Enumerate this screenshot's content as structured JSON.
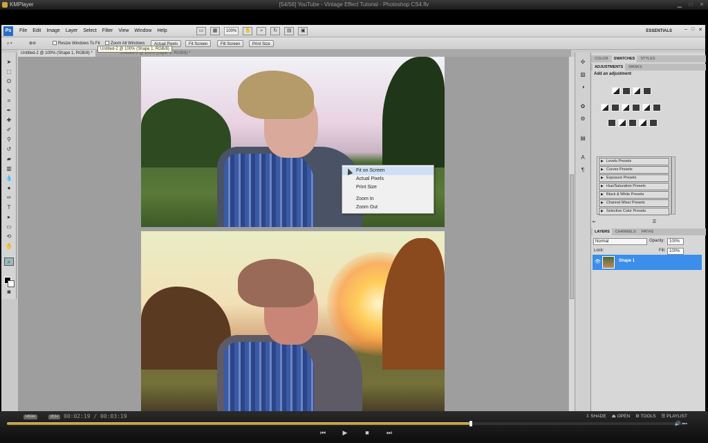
{
  "player": {
    "app_name": "KMPlayer",
    "title": "[54/56] YouTube - Vintage Effect Tutorial - Photoshop CS4.flv",
    "badge_hq": "HIGH",
    "badge_2ch": "2CH",
    "timecode": "00:02:19 / 00:03:19",
    "progress": 0.685,
    "controls": {
      "shade": "SHADE",
      "open": "OPEN",
      "tools": "TOOLS",
      "playlist": "PLAYLIST"
    }
  },
  "photoshop": {
    "logo": "Ps",
    "menus": [
      "File",
      "Edit",
      "Image",
      "Layer",
      "Select",
      "Filter",
      "View",
      "Window",
      "Help"
    ],
    "zoom": "100%",
    "workspace": "ESSENTIALS",
    "options": {
      "resize": "Resize Windows To Fit",
      "zoom_all": "Zoom All Windows",
      "actual_pixels": "Actual Pixels",
      "fit_screen": "Fit Screen",
      "fill_screen": "Fill Screen",
      "print_size": "Print Size"
    },
    "tooltip": "Untitled-2 @ 100% (Shape 1, RGB/8)",
    "doc_tabs": [
      "Untitled-2 @ 100% (Shape 1, RGB/8) *",
      "Untitled-1 @ 100% (Layer 1, RGB/8) *"
    ],
    "context_menu": [
      "Fit on Screen",
      "Actual Pixels",
      "Print Size",
      "Zoom In",
      "Zoom Out"
    ],
    "panel_tabs_top": [
      "COLOR",
      "SWATCHES",
      "STYLES"
    ],
    "panel_tabs_adj": [
      "ADJUSTMENTS",
      "MASKS"
    ],
    "adj_title": "Add an adjustment",
    "presets": [
      "Levels Presets",
      "Curves Presets",
      "Exposure Presets",
      "Hue/Saturation Presets",
      "Black & White Presets",
      "Channel Mixer Presets",
      "Selective Color Presets"
    ],
    "layer_tabs": [
      "LAYERS",
      "CHANNELS",
      "PATHS"
    ],
    "blend_mode": "Normal",
    "opacity_label": "Opacity:",
    "opacity": "100%",
    "lock_label": "Lock:",
    "fill_label": "Fill:",
    "fill": "100%",
    "layer_name": "Shape 1"
  }
}
